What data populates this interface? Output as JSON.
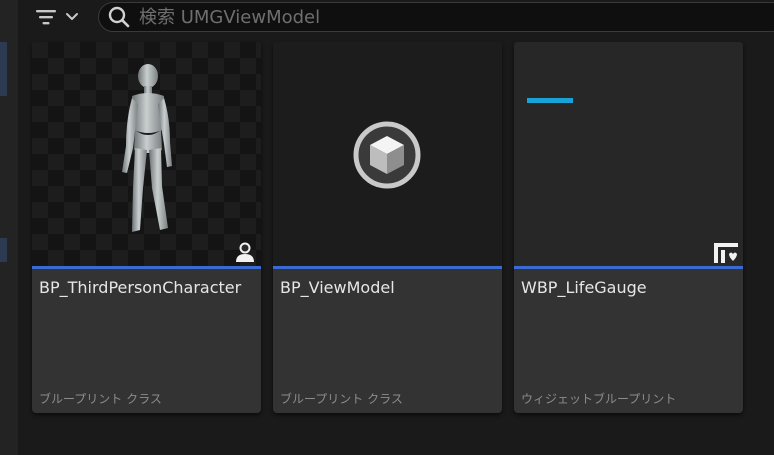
{
  "toolbar": {
    "search_placeholder": "検索 UMGViewModel"
  },
  "colors": {
    "blueprint_type_bar": "#3a6ad4",
    "lifegauge_bar": "#19a2d6"
  },
  "assets": [
    {
      "name": "BP_ThirdPersonCharacter",
      "type": "ブループリント クラス",
      "thumbnail": "mannequin-preview",
      "badge_icon": "character-icon"
    },
    {
      "name": "BP_ViewModel",
      "type": "ブループリント クラス",
      "thumbnail": "cube-object-icon",
      "badge_icon": ""
    },
    {
      "name": "WBP_LifeGauge",
      "type": "ウィジェットブループリント",
      "thumbnail": "widget-preview",
      "badge_icon": "widget-icon"
    }
  ]
}
